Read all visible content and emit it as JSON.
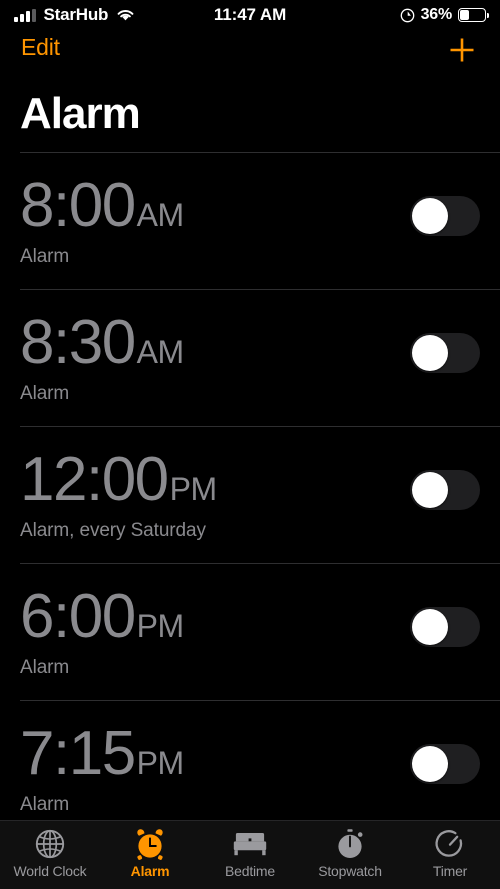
{
  "status_bar": {
    "carrier": "StarHub",
    "time": "11:47 AM",
    "battery_percent": "36%",
    "battery_level": 36,
    "signal_icon": "cellular-bars-icon",
    "wifi_icon": "wifi-icon",
    "location_icon": "location-arrow-icon",
    "battery_icon": "battery-icon"
  },
  "nav": {
    "edit_label": "Edit",
    "add_icon": "plus-icon"
  },
  "header": {
    "title": "Alarm"
  },
  "alarms": [
    {
      "time": "8:00",
      "period": "AM",
      "label": "Alarm",
      "enabled": false
    },
    {
      "time": "8:30",
      "period": "AM",
      "label": "Alarm",
      "enabled": false
    },
    {
      "time": "12:00",
      "period": "PM",
      "label": "Alarm, every Saturday",
      "enabled": false
    },
    {
      "time": "6:00",
      "period": "PM",
      "label": "Alarm",
      "enabled": false
    },
    {
      "time": "7:15",
      "period": "PM",
      "label": "Alarm",
      "enabled": false
    }
  ],
  "tabs": [
    {
      "label": "World Clock",
      "icon": "globe-icon",
      "active": false
    },
    {
      "label": "Alarm",
      "icon": "alarm-clock-icon",
      "active": true
    },
    {
      "label": "Bedtime",
      "icon": "bed-icon",
      "active": false
    },
    {
      "label": "Stopwatch",
      "icon": "stopwatch-icon",
      "active": false
    },
    {
      "label": "Timer",
      "icon": "timer-icon",
      "active": false
    }
  ],
  "colors": {
    "accent": "#ff9500",
    "background": "#000000",
    "text_primary": "#ffffff",
    "text_secondary": "#8a8a8e",
    "separator": "#2e2e30",
    "switch_off_track": "#1f1f21",
    "tab_inactive": "#9a9a9e"
  }
}
